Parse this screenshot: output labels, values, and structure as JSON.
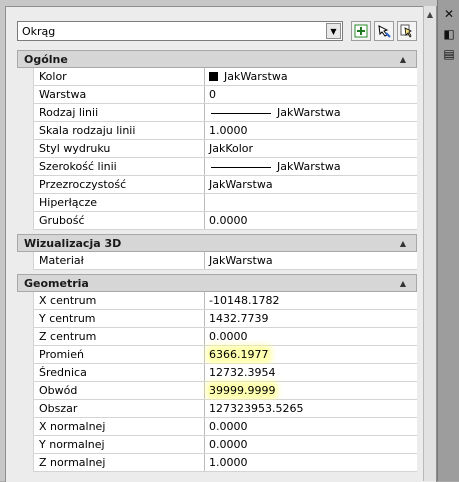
{
  "object_type": "Okrąg",
  "toolbar": {
    "quick_select_icon": "quick-select-icon",
    "select_objects_icon": "select-objects-icon",
    "toggle_pickadd_icon": "toggle-pickadd-icon"
  },
  "sections": {
    "general": {
      "title": "Ogólne",
      "rows": [
        {
          "label": "Kolor",
          "value": "JakWarstwa"
        },
        {
          "label": "Warstwa",
          "value": "0"
        },
        {
          "label": "Rodzaj linii",
          "value": "JakWarstwa"
        },
        {
          "label": "Skala rodzaju linii",
          "value": "1.0000"
        },
        {
          "label": "Styl wydruku",
          "value": "JakKolor"
        },
        {
          "label": "Szerokość linii",
          "value": "JakWarstwa"
        },
        {
          "label": "Przezroczystość",
          "value": "JakWarstwa"
        },
        {
          "label": "Hiperłącze",
          "value": ""
        },
        {
          "label": "Grubość",
          "value": "0.0000"
        }
      ]
    },
    "viz3d": {
      "title": "Wizualizacja 3D",
      "rows": [
        {
          "label": "Materiał",
          "value": "JakWarstwa"
        }
      ]
    },
    "geometry": {
      "title": "Geometria",
      "rows": [
        {
          "label": "X centrum",
          "value": "-10148.1782"
        },
        {
          "label": "Y centrum",
          "value": "1432.7739"
        },
        {
          "label": "Z centrum",
          "value": "0.0000"
        },
        {
          "label": "Promień",
          "value": "6366.1977"
        },
        {
          "label": "Średnica",
          "value": "12732.3954"
        },
        {
          "label": "Obwód",
          "value": "39999.9999"
        },
        {
          "label": "Obszar",
          "value": "127323953.5265"
        },
        {
          "label": "X normalnej",
          "value": "0.0000"
        },
        {
          "label": "Y normalnej",
          "value": "0.0000"
        },
        {
          "label": "Z normalnej",
          "value": "1.0000"
        }
      ]
    }
  },
  "colors": {
    "highlight": "#ffff96",
    "section_bg": "#d6d6d6"
  }
}
